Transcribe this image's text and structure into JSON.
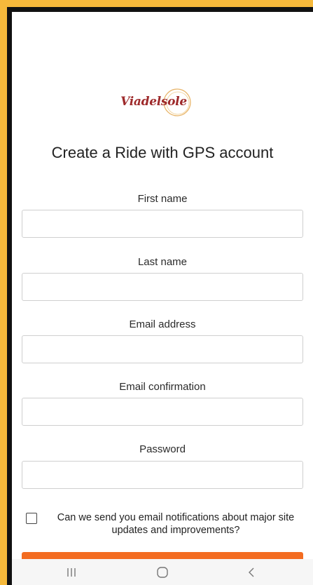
{
  "brand": {
    "logo_text": "Viadelsole"
  },
  "page": {
    "title": "Create a Ride with GPS account"
  },
  "form": {
    "fields": [
      {
        "label": "First name",
        "value": ""
      },
      {
        "label": "Last name",
        "value": ""
      },
      {
        "label": "Email address",
        "value": ""
      },
      {
        "label": "Email confirmation",
        "value": ""
      },
      {
        "label": "Password",
        "value": ""
      }
    ],
    "notifications_checkbox": {
      "label": "Can we send you email notifications about major site updates and improvements?",
      "checked": false
    }
  },
  "navigation_bar": {
    "buttons": [
      {
        "icon": "recent-apps-icon"
      },
      {
        "icon": "home-icon"
      },
      {
        "icon": "back-icon"
      }
    ]
  },
  "colors": {
    "background": "#f6b93b",
    "submit_button": "#f36c21",
    "logo_text": "#9e2a2b",
    "logo_ring": "#e8b56a"
  }
}
